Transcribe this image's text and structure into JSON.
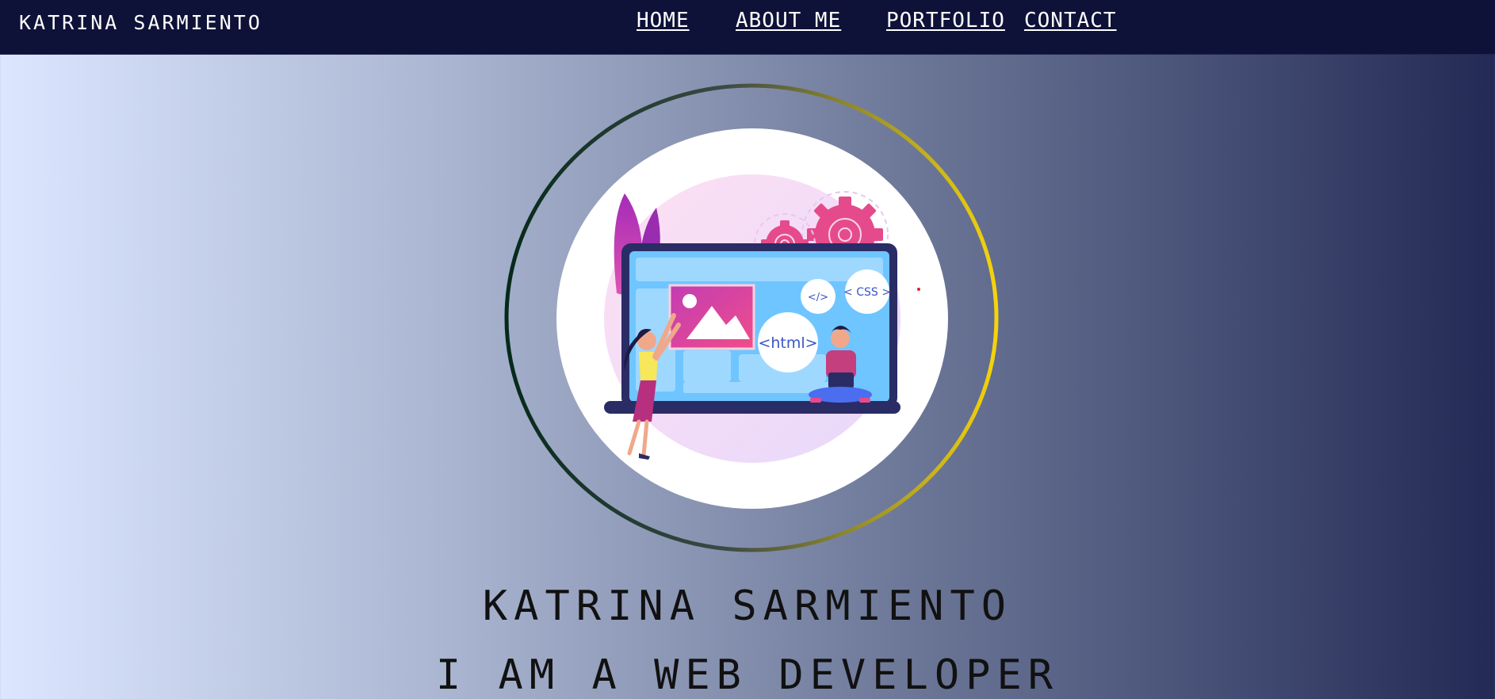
{
  "brand": {
    "first": "Katrina",
    "last": "Sarmiento"
  },
  "nav": {
    "items": [
      {
        "label": "Home"
      },
      {
        "label": "About Me"
      },
      {
        "label": "Portfolio"
      },
      {
        "label": "Contact"
      }
    ]
  },
  "hero": {
    "name_first": "Katrina",
    "name_last": "Sarmiento",
    "role_prefix": "I am a web",
    "role_suffix": "Developer"
  },
  "illustration": {
    "badge_html": "<html>",
    "badge_css": "< CSS >",
    "badge_code": "</>"
  },
  "colors": {
    "navbar": "#0e1238",
    "ring_dark": "#052a1a",
    "ring_gold": "#f6d40b",
    "accent_pink": "#d83f88"
  }
}
